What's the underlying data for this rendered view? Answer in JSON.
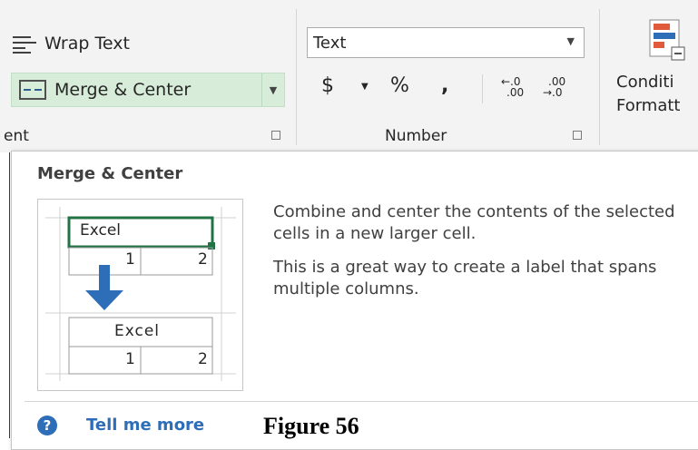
{
  "ribbon": {
    "alignment": {
      "wrap_text_label": "Wrap Text",
      "merge_center_label": "Merge & Center",
      "group_label_partial": "ent"
    },
    "number": {
      "format_value": "Text",
      "currency_symbol": "$",
      "percent_symbol": "%",
      "comma_symbol": ",",
      "increase_decimal_top": "←.0",
      "increase_decimal_bottom": ".00",
      "decrease_decimal_top": ".00",
      "decrease_decimal_bottom": "→.0",
      "group_label": "Number"
    },
    "styles": {
      "conditional_line1": "Conditi",
      "conditional_line2": "Formatt"
    }
  },
  "tooltip": {
    "title": "Merge & Center",
    "description_1": "Combine and center the contents of the selected cells in a new larger cell.",
    "description_2": "This is a great way to create a label that spans multiple columns.",
    "help_link": "Tell me more",
    "illustration": {
      "top_cell_text": "Excel",
      "top_row_values": [
        "1",
        "2"
      ],
      "bottom_cell_text": "Excel",
      "bottom_row_values": [
        "1",
        "2"
      ]
    }
  },
  "caption": "Figure 56",
  "colors": {
    "accent_blue": "#2e6eb8",
    "selection_green": "#217346",
    "merge_highlight": "#d7ecd9"
  }
}
